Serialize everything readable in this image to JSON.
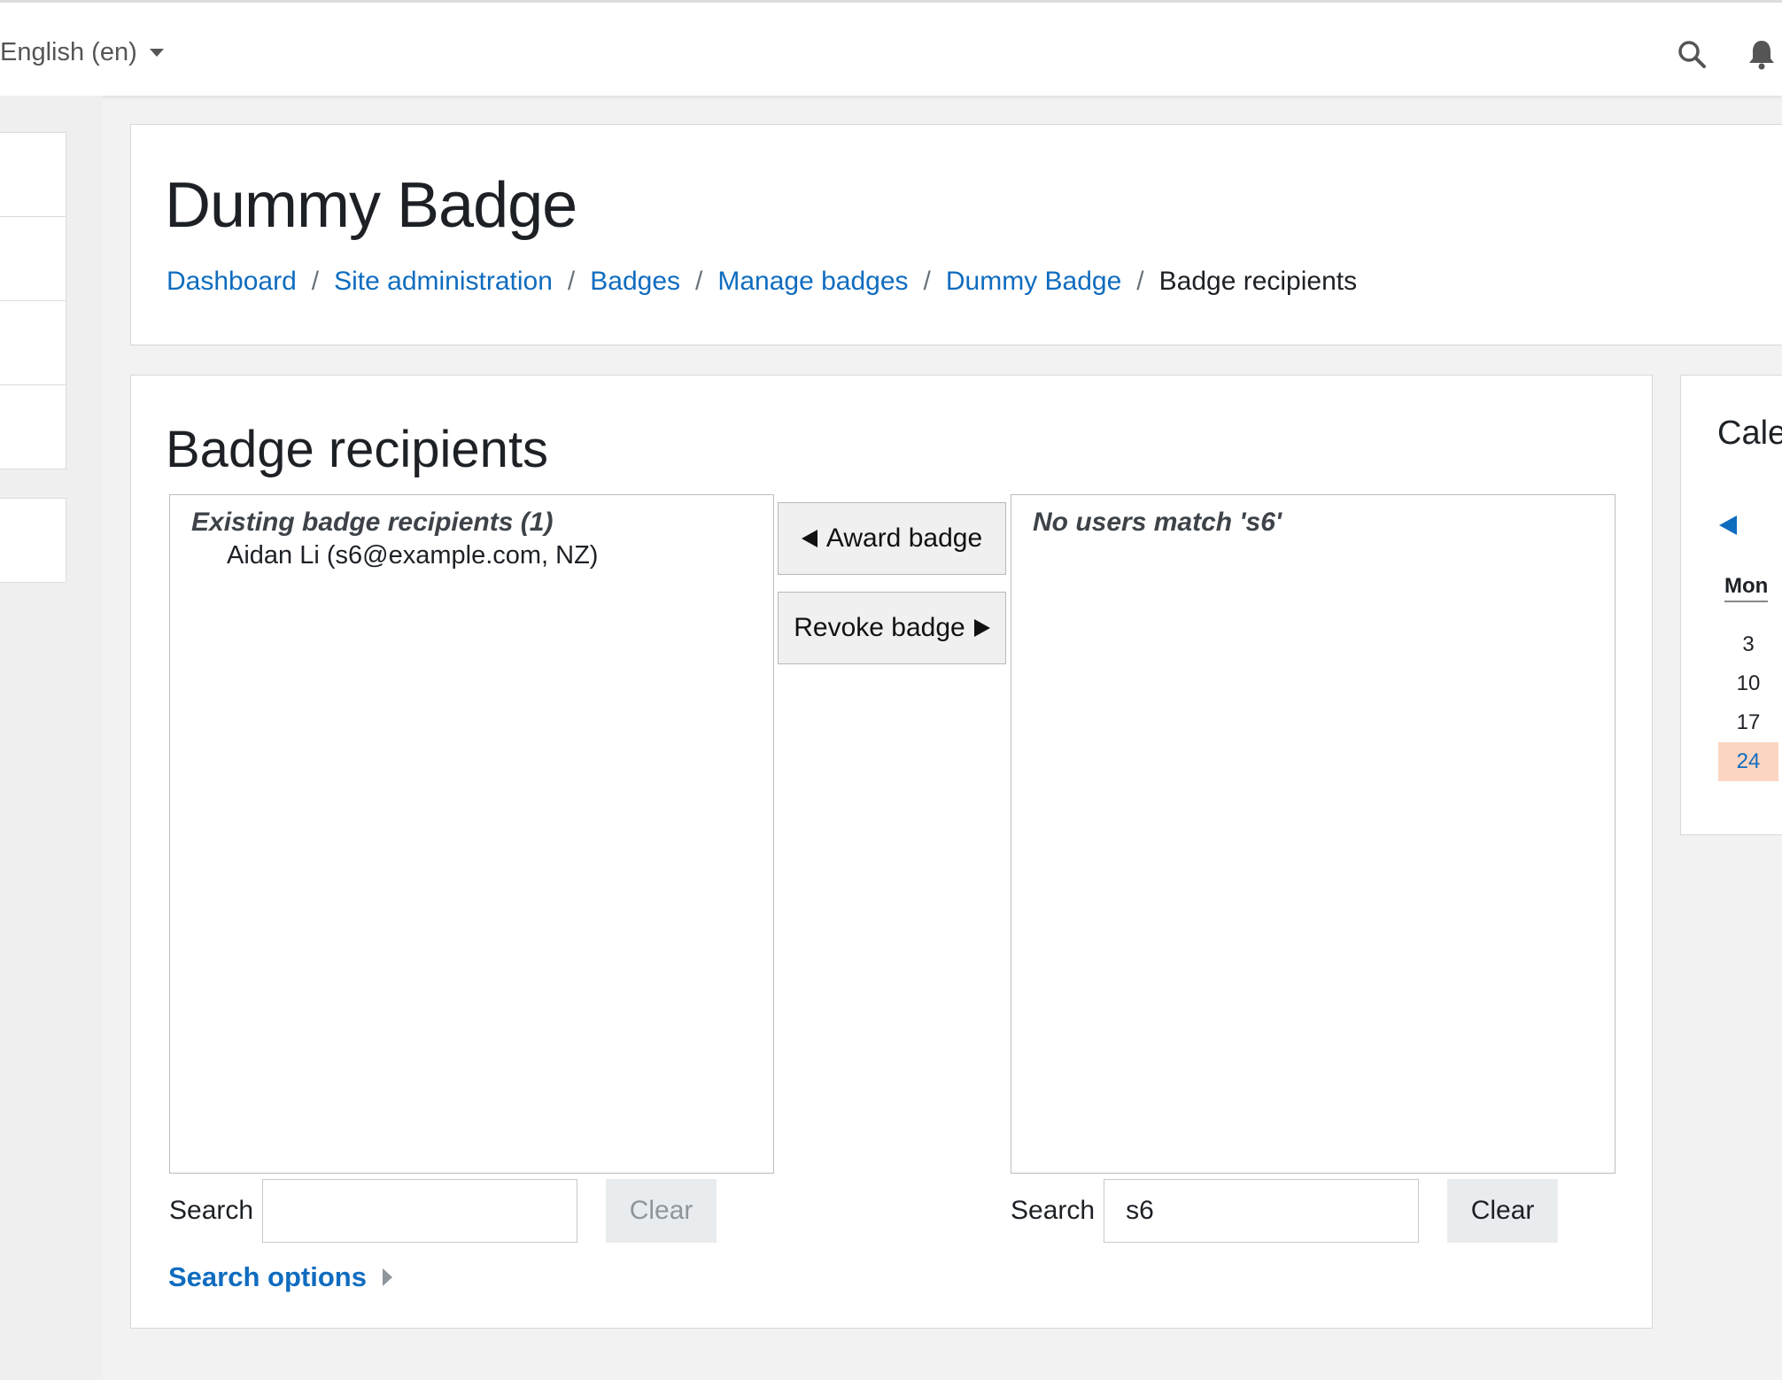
{
  "topbar": {
    "language": "English (en)"
  },
  "header": {
    "title": "Dummy Badge",
    "breadcrumb": [
      {
        "label": "Dashboard"
      },
      {
        "label": "Site administration"
      },
      {
        "label": "Badges"
      },
      {
        "label": "Manage badges"
      },
      {
        "label": "Dummy Badge"
      },
      {
        "label": "Badge recipients"
      }
    ]
  },
  "main": {
    "title": "Badge recipients",
    "existing": {
      "group_label": "Existing badge recipients (1)",
      "options": [
        "Aidan Li (s6@example.com, NZ)"
      ],
      "search_label": "Search",
      "search_value": "",
      "clear_label": "Clear"
    },
    "award_label": "Award badge",
    "revoke_label": "Revoke badge",
    "potential": {
      "group_label": "No users match 's6'",
      "search_label": "Search",
      "search_value": "s6",
      "clear_label": "Clear"
    },
    "search_options_label": "Search options"
  },
  "calendar": {
    "title": "Cale",
    "day_header": "Mon",
    "dates": [
      "3",
      "10",
      "17",
      "24"
    ],
    "today": "24"
  },
  "colors": {
    "link": "#0f6cbf",
    "today_highlight": "#fbd5c1"
  }
}
